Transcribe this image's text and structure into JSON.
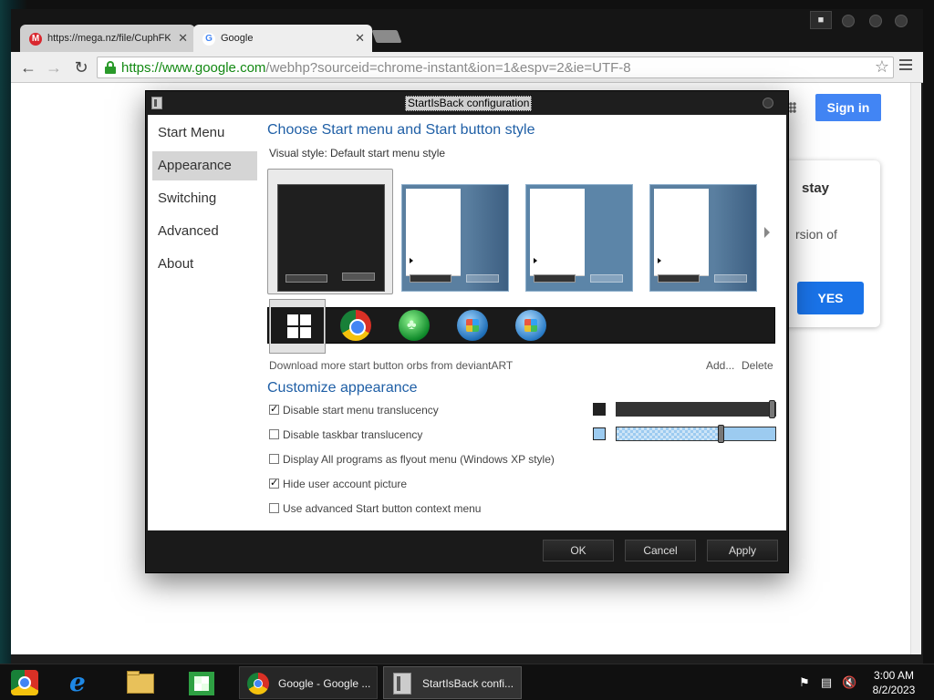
{
  "browser": {
    "tabs": [
      {
        "label": "https://mega.nz/file/CuphFKS",
        "icon": "mega-icon"
      },
      {
        "label": "Google",
        "icon": "google-icon"
      }
    ],
    "url_host": "https://www.google.com",
    "url_path": "/webhp?sourceid=chrome-instant&ion=1&espv=2&ie=UTF-8",
    "page": {
      "signin_label": "Sign in",
      "promo_title": "stay",
      "promo_text": "rsion of",
      "yes_label": "YES"
    }
  },
  "dialog": {
    "title": "StartIsBack configuration",
    "nav": [
      "Start Menu",
      "Appearance",
      "Switching",
      "Advanced",
      "About"
    ],
    "active_nav": "Appearance",
    "section1_title": "Choose Start menu and Start button style",
    "visual_style_label": "Visual style:",
    "visual_style_value": "Default start menu style",
    "download_link": "Download more start button orbs from deviantART",
    "add_link": "Add...",
    "delete_link": "Delete",
    "section2_title": "Customize appearance",
    "options": [
      {
        "label": "Disable start menu translucency",
        "checked": true
      },
      {
        "label": "Disable taskbar translucency",
        "checked": false
      },
      {
        "label": "Display All programs as flyout menu (Windows XP style)",
        "checked": false
      },
      {
        "label": "Hide user account picture",
        "checked": true
      },
      {
        "label": "Use advanced Start button context menu",
        "checked": false
      }
    ],
    "start_menu_color": "#222222",
    "taskbar_color": "#9ccbf0",
    "ok_label": "OK",
    "cancel_label": "Cancel",
    "apply_label": "Apply"
  },
  "taskbar": {
    "tasks": [
      {
        "label": "Google - Google ...",
        "icon": "chrome-icon"
      },
      {
        "label": "StartIsBack confi...",
        "icon": "startisback-icon"
      }
    ],
    "clock_time": "3:00 AM",
    "clock_date": "8/2/2023"
  }
}
